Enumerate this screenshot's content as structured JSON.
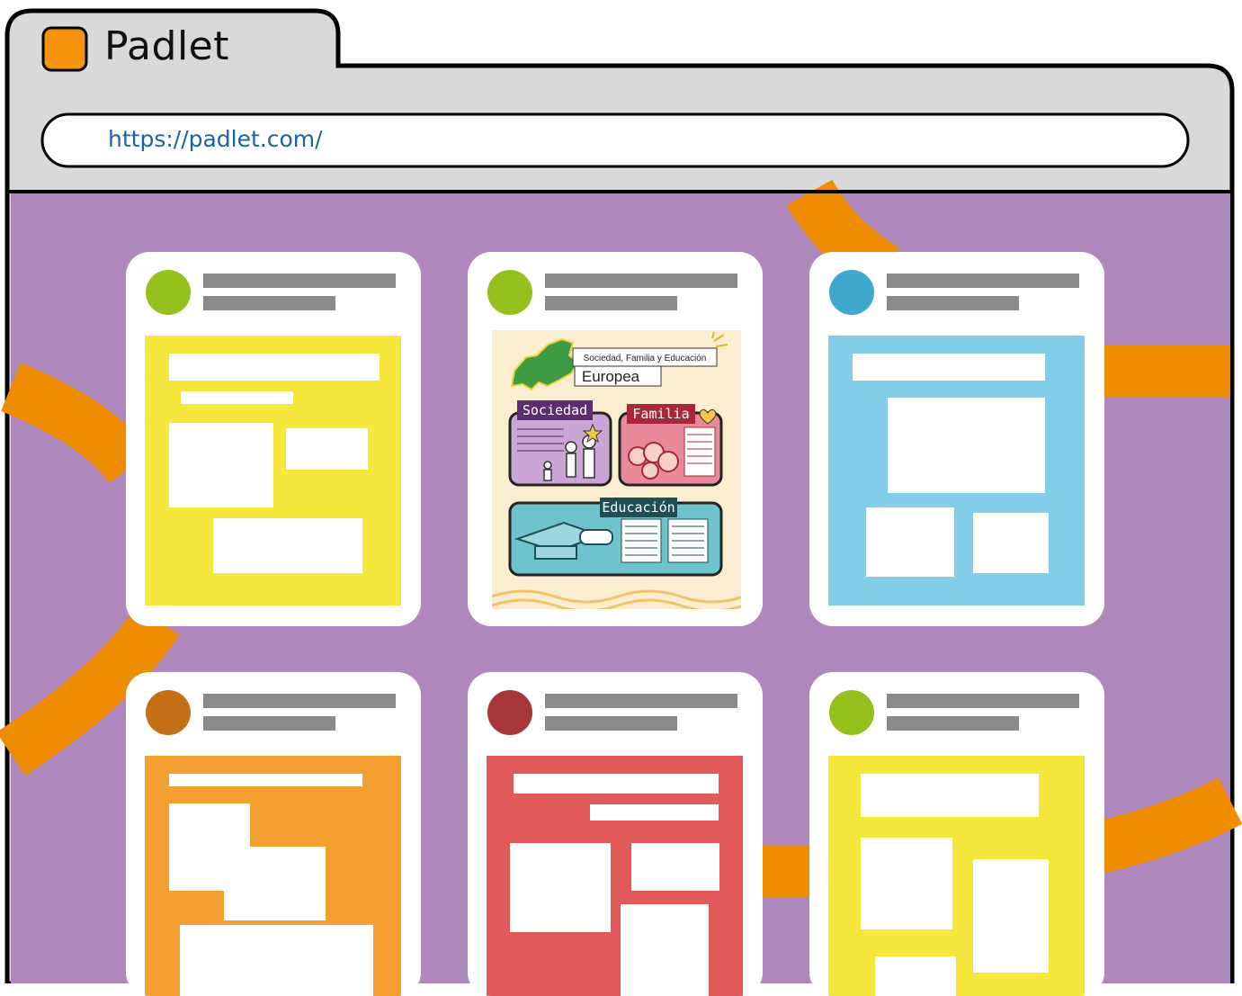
{
  "browser": {
    "tab_title": "Padlet",
    "url": "https://padlet.com/",
    "tab_icon_color": "#F5930F"
  },
  "board": {
    "background_color": "#AE87BC",
    "ribbon_color": "#F08C00",
    "cards": [
      {
        "avatar_color": "#95C11F",
        "post_color": "#F6E73C"
      },
      {
        "avatar_color": "#95C11F",
        "post_type": "image"
      },
      {
        "avatar_color": "#3EA8CE",
        "post_color": "#82CDE8"
      },
      {
        "avatar_color": "#C46F16",
        "post_color": "#F4A031"
      },
      {
        "avatar_color": "#A8353A",
        "post_color": "#E05A5A"
      },
      {
        "avatar_color": "#95C11F",
        "post_color": "#F6E73C"
      }
    ]
  },
  "poster": {
    "subtitle": "Sociedad, Familia y Educación",
    "title": "Europea",
    "section_society": "Sociedad",
    "section_family": "Familia",
    "section_education": "Educación",
    "background_color": "#FBEDCF"
  }
}
